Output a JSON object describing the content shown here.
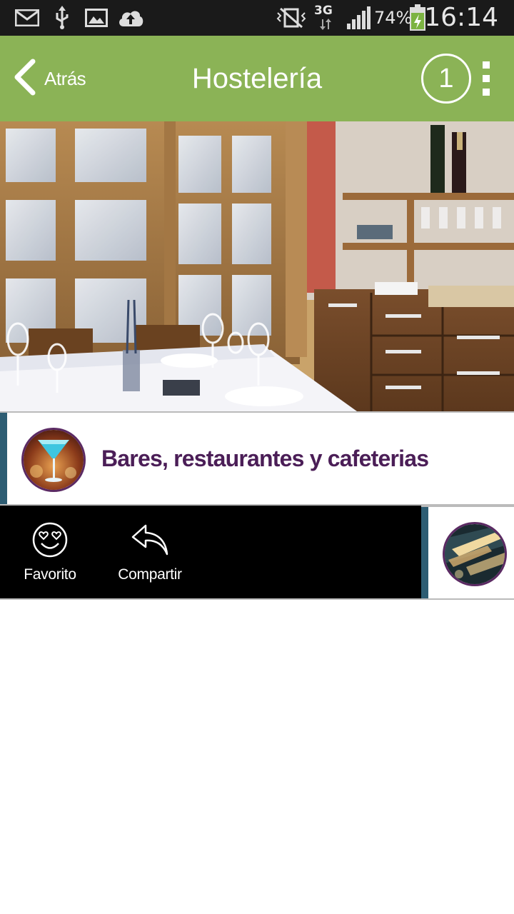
{
  "status_bar": {
    "icons": [
      "mail-icon",
      "usb-icon",
      "image-icon",
      "cloud-upload-icon",
      "vibrate-silent-icon",
      "signal-icon",
      "battery-charging-icon"
    ],
    "network": "3G",
    "battery": "74%",
    "time": "16:14"
  },
  "header": {
    "back_label": "Atrás",
    "title": "Hostelería",
    "badge_count": "1",
    "background": "#8bb356"
  },
  "category": {
    "title": "Bares, restaurantes y cafeterias",
    "accent": "#2e5d73",
    "title_color": "#4b1e57"
  },
  "actions": {
    "favorite_label": "Favorito",
    "share_label": "Compartir"
  }
}
